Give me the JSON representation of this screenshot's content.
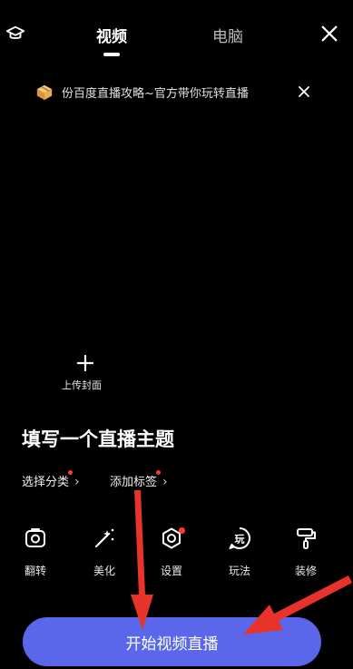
{
  "header": {
    "tabs": [
      {
        "label": "视频",
        "active": true
      },
      {
        "label": "电脑",
        "active": false
      }
    ],
    "left_icon": "graduation-cap-icon",
    "close_icon": "close-icon"
  },
  "banner": {
    "icon": "gift-box-icon",
    "text": "份百度直播攻略~官方带你玩转直播",
    "close_icon": "close-icon"
  },
  "cover": {
    "icon": "plus-icon",
    "label": "上传封面"
  },
  "title_placeholder": "填写一个直播主题",
  "options": {
    "category": "选择分类",
    "tags": "添加标签"
  },
  "tools": [
    {
      "label": "翻转",
      "icon": "flip-camera-icon"
    },
    {
      "label": "美化",
      "icon": "magic-wand-icon"
    },
    {
      "label": "设置",
      "icon": "settings-gear-icon",
      "badge": true
    },
    {
      "label": "玩法",
      "icon": "play-mode-icon"
    },
    {
      "label": "装修",
      "icon": "paint-roller-icon"
    }
  ],
  "start_button": "开始视频直播",
  "colors": {
    "background": "#000000",
    "button": "#5b67ea",
    "badge": "#ff3b30",
    "annotation_arrow": "#e8332a"
  }
}
